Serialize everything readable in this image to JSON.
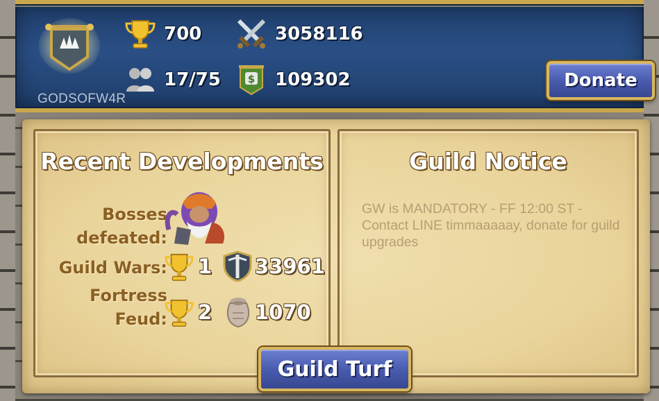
{
  "guild": {
    "name": "GODSOFW4R",
    "trophies": "700",
    "might": "3058116",
    "members": "17/75",
    "funds": "109302"
  },
  "buttons": {
    "donate": "Donate",
    "guild_turf": "Guild Turf"
  },
  "recent": {
    "title": "Recent Developments",
    "bosses_label_1": "Bosses",
    "bosses_label_2": "defeated:",
    "guild_wars_label": "Guild Wars:",
    "guild_wars_wins": "1",
    "guild_wars_points": "33961",
    "fortress_label_1": "Fortress",
    "fortress_label_2": "Feud:",
    "fortress_wins": "2",
    "fortress_points": "1070"
  },
  "notice": {
    "title": "Guild Notice",
    "text": "GW is MANDATORY - FF 12:00 ST - Contact LINE timmaaaaay, donate for guild upgrades"
  },
  "colors": {
    "banner_blue": "#2a4f85",
    "gold_trim": "#c9a84c",
    "button_blue": "#4a5cb0",
    "parchment": "#e9d49b",
    "label_brown": "#8a5f22"
  },
  "icons": [
    "guild-emblem-icon",
    "trophy-icon",
    "crossed-swords-icon",
    "members-icon",
    "guild-coin-banner-icon",
    "boss-portrait-icon",
    "shield-icon",
    "grain-sack-icon"
  ]
}
